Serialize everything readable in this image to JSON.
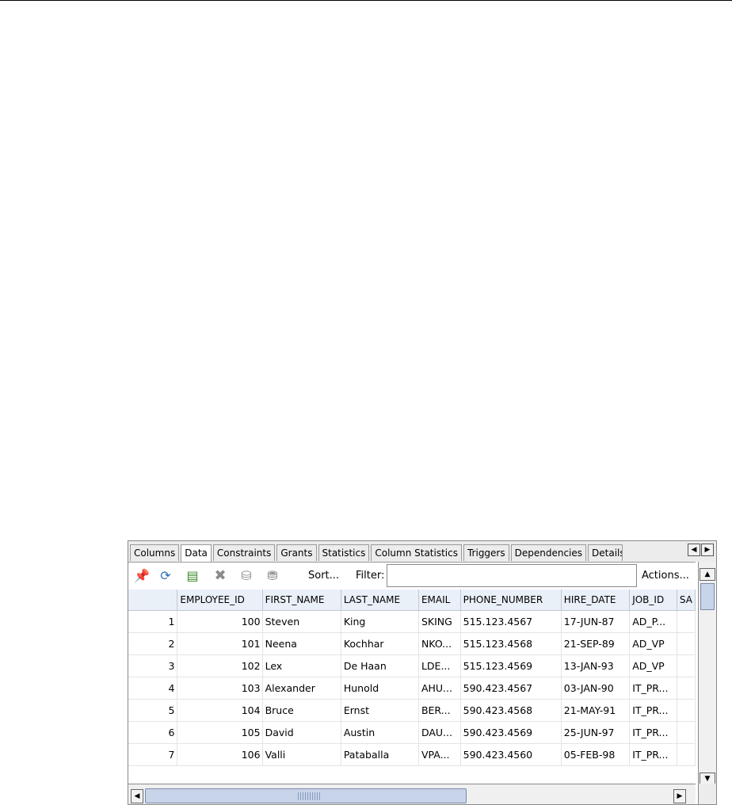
{
  "tabs": [
    {
      "label": "Columns",
      "active": false
    },
    {
      "label": "Data",
      "active": true
    },
    {
      "label": "Constraints",
      "active": false
    },
    {
      "label": "Grants",
      "active": false
    },
    {
      "label": "Statistics",
      "active": false
    },
    {
      "label": "Column Statistics",
      "active": false
    },
    {
      "label": "Triggers",
      "active": false
    },
    {
      "label": "Dependencies",
      "active": false
    },
    {
      "label": "Details",
      "active": false
    }
  ],
  "toolbar": {
    "icons": [
      "pin-icon",
      "refresh-icon",
      "insert-row-icon",
      "delete-row-icon",
      "commit-icon",
      "rollback-icon"
    ],
    "sort_label": "Sort...",
    "filter_label": "Filter:",
    "filter_value": "",
    "actions_label": "Actions..."
  },
  "grid": {
    "columns": [
      "",
      "EMPLOYEE_ID",
      "FIRST_NAME",
      "LAST_NAME",
      "EMAIL",
      "PHONE_NUMBER",
      "HIRE_DATE",
      "JOB_ID",
      "SA"
    ],
    "rows": [
      [
        "1",
        "100",
        "Steven",
        "King",
        "SKING",
        "515.123.4567",
        "17-JUN-87",
        "AD_P...",
        ""
      ],
      [
        "2",
        "101",
        "Neena",
        "Kochhar",
        "NKO...",
        "515.123.4568",
        "21-SEP-89",
        "AD_VP",
        ""
      ],
      [
        "3",
        "102",
        "Lex",
        "De Haan",
        "LDE...",
        "515.123.4569",
        "13-JAN-93",
        "AD_VP",
        ""
      ],
      [
        "4",
        "103",
        "Alexander",
        "Hunold",
        "AHU...",
        "590.423.4567",
        "03-JAN-90",
        "IT_PR...",
        ""
      ],
      [
        "5",
        "104",
        "Bruce",
        "Ernst",
        "BER...",
        "590.423.4568",
        "21-MAY-91",
        "IT_PR...",
        ""
      ],
      [
        "6",
        "105",
        "David",
        "Austin",
        "DAU...",
        "590.423.4569",
        "25-JUN-97",
        "IT_PR...",
        ""
      ],
      [
        "7",
        "106",
        "Valli",
        "Pataballa",
        "VPA...",
        "590.423.4560",
        "05-FEB-98",
        "IT_PR...",
        ""
      ]
    ]
  },
  "colors": {
    "header_bg": "#eaf0f8",
    "scroll_thumb": "#c8d4ea",
    "pin_red": "#c01010"
  }
}
